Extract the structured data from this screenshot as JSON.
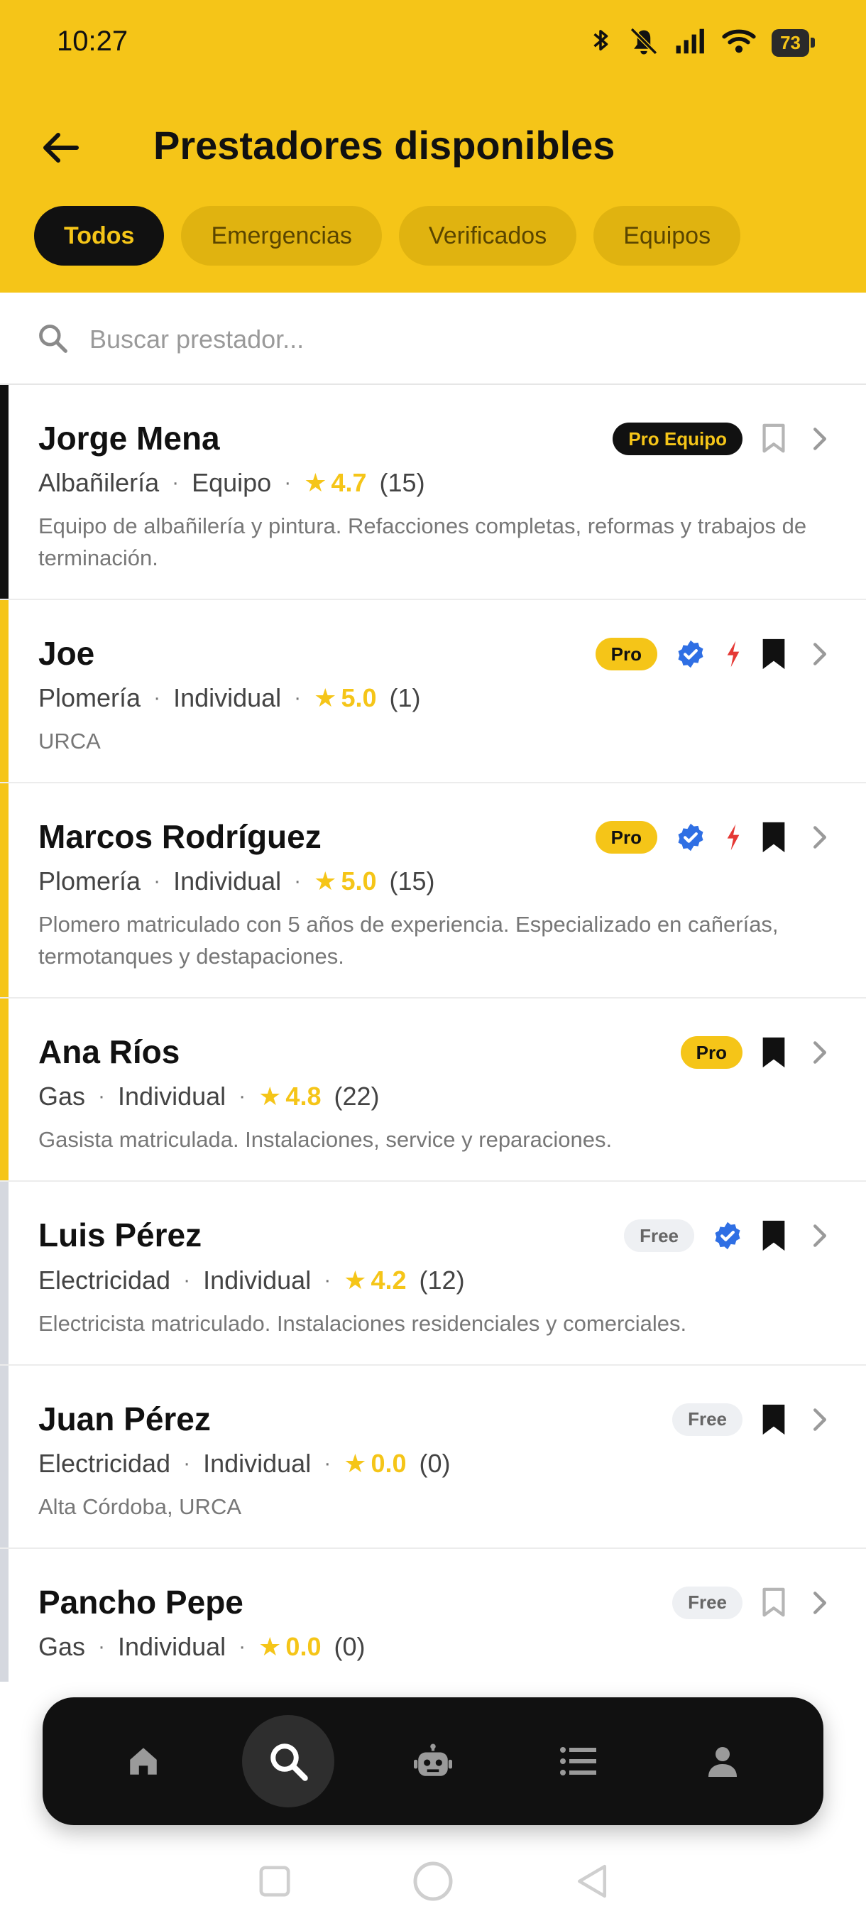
{
  "status_bar": {
    "time": "10:27",
    "battery": "73"
  },
  "header": {
    "title": "Prestadores disponibles"
  },
  "filters": [
    {
      "label": "Todos",
      "active": true
    },
    {
      "label": "Emergencias",
      "active": false
    },
    {
      "label": "Verificados",
      "active": false
    },
    {
      "label": "Equipos",
      "active": false
    }
  ],
  "search": {
    "placeholder": "Buscar prestador...",
    "value": ""
  },
  "providers": [
    {
      "name": "Jorge Mena",
      "category": "Albañilería",
      "type": "Equipo",
      "rating": "4.7",
      "count": "(15)",
      "desc": "Equipo de albañilería y pintura. Refacciones completas, reformas y trabajos de terminación.",
      "plan": "Pro Equipo",
      "verified": false,
      "emergency": false,
      "saved": false,
      "accent": "#111111"
    },
    {
      "name": "Joe",
      "category": "Plomería",
      "type": "Individual",
      "rating": "5.0",
      "count": "(1)",
      "desc": "URCA",
      "plan": "Pro",
      "verified": true,
      "emergency": true,
      "saved": true,
      "accent": "#f5c518"
    },
    {
      "name": "Marcos Rodríguez",
      "category": "Plomería",
      "type": "Individual",
      "rating": "5.0",
      "count": "(15)",
      "desc": "Plomero matriculado con 5 años de experiencia. Especializado en cañerías, termotanques y destapaciones.",
      "plan": "Pro",
      "verified": true,
      "emergency": true,
      "saved": true,
      "accent": "#f5c518"
    },
    {
      "name": "Ana Ríos",
      "category": "Gas",
      "type": "Individual",
      "rating": "4.8",
      "count": "(22)",
      "desc": "Gasista matriculada. Instalaciones, service y reparaciones.",
      "plan": "Pro",
      "verified": false,
      "emergency": false,
      "saved": true,
      "accent": "#f5c518"
    },
    {
      "name": "Luis Pérez",
      "category": "Electricidad",
      "type": "Individual",
      "rating": "4.2",
      "count": "(12)",
      "desc": "Electricista matriculado. Instalaciones residenciales y comerciales.",
      "plan": "Free",
      "verified": true,
      "emergency": false,
      "saved": true,
      "accent": "#d5d8df"
    },
    {
      "name": "Juan Pérez",
      "category": "Electricidad",
      "type": "Individual",
      "rating": "0.0",
      "count": "(0)",
      "desc": "Alta Córdoba, URCA",
      "plan": "Free",
      "verified": false,
      "emergency": false,
      "saved": true,
      "accent": "#d5d8df"
    },
    {
      "name": "Pancho Pepe",
      "category": "Gas",
      "type": "Individual",
      "rating": "0.0",
      "count": "(0)",
      "desc": "",
      "plan": "Free",
      "verified": false,
      "emergency": false,
      "saved": false,
      "accent": "#d5d8df"
    }
  ],
  "bottom_nav": [
    {
      "icon": "home-icon",
      "active": false
    },
    {
      "icon": "search-icon",
      "active": true
    },
    {
      "icon": "robot-icon",
      "active": false
    },
    {
      "icon": "list-icon",
      "active": false
    },
    {
      "icon": "person-icon",
      "active": false
    }
  ],
  "colors": {
    "brand": "#f5c518",
    "dark": "#111111",
    "verified": "#2f6fe4",
    "emergency": "#e53935"
  }
}
